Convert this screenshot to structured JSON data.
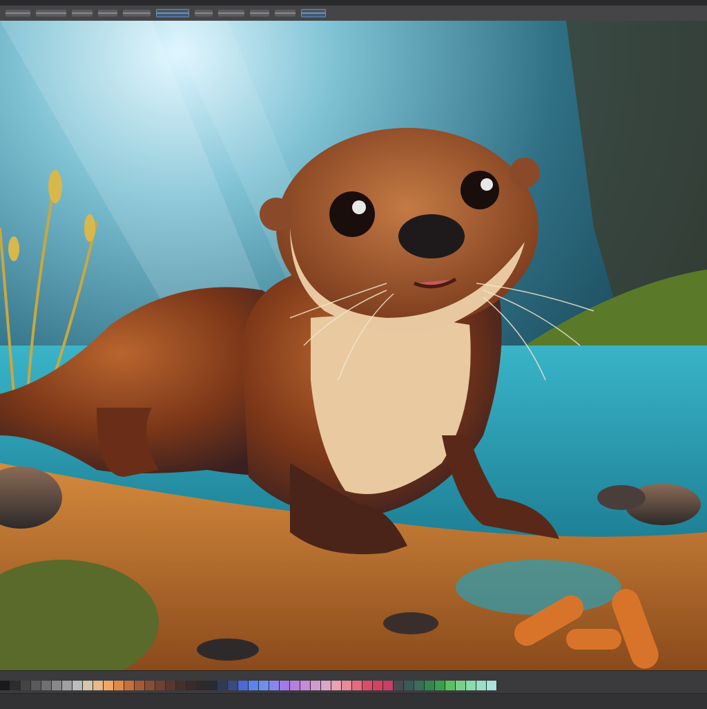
{
  "app": {
    "accent_color": "#6a8fb8",
    "toolbar": {
      "tools": [
        {
          "icon": "file-icon",
          "active": false
        },
        {
          "icon": "edit-icon",
          "active": false
        },
        {
          "icon": "image-icon",
          "active": false
        },
        {
          "icon": "layer-icon",
          "active": false
        },
        {
          "icon": "select-icon",
          "active": false
        },
        {
          "icon": "filter-icon",
          "active": true
        },
        {
          "icon": "view-icon",
          "active": false
        },
        {
          "icon": "window-icon",
          "active": false
        },
        {
          "icon": "help-icon",
          "active": false
        },
        {
          "icon": "extra-icon",
          "active": false
        },
        {
          "icon": "panel-icon",
          "active": true
        }
      ]
    },
    "canvas": {
      "subject": "otter-illustration",
      "colors": {
        "water": "#2aa0b5",
        "fur": "#8a3d1c",
        "belly": "#e9c9a0",
        "sand": "#b86a24"
      }
    },
    "swatches": [
      "#1a1a1a",
      "#2d2d2d",
      "#444444",
      "#5a5a5a",
      "#707070",
      "#888888",
      "#a0a0a0",
      "#bcbcbc",
      "#d6c7a8",
      "#e8b98a",
      "#f0a866",
      "#e08a4a",
      "#c86e3a",
      "#a65a34",
      "#8a4c32",
      "#704034",
      "#5a3630",
      "#46302c",
      "#3c2a2a",
      "#30282a",
      "#2a2a34",
      "#303a58",
      "#3a4a80",
      "#4a6ad8",
      "#5a84f0",
      "#6e8ef0",
      "#8a86f0",
      "#a07ae8",
      "#b87ee0",
      "#c88ad8",
      "#d49ad0",
      "#dca6c8",
      "#e8a2b0",
      "#e88a9a",
      "#e86a80",
      "#e04a6a",
      "#d84060",
      "#c84068",
      "#4a4a50",
      "#3a5a5a",
      "#3a6e5a",
      "#2e8a4a",
      "#3aa04a",
      "#5ac060",
      "#7ad08a",
      "#8adcaa",
      "#98e0c8",
      "#a8e4dc"
    ]
  }
}
